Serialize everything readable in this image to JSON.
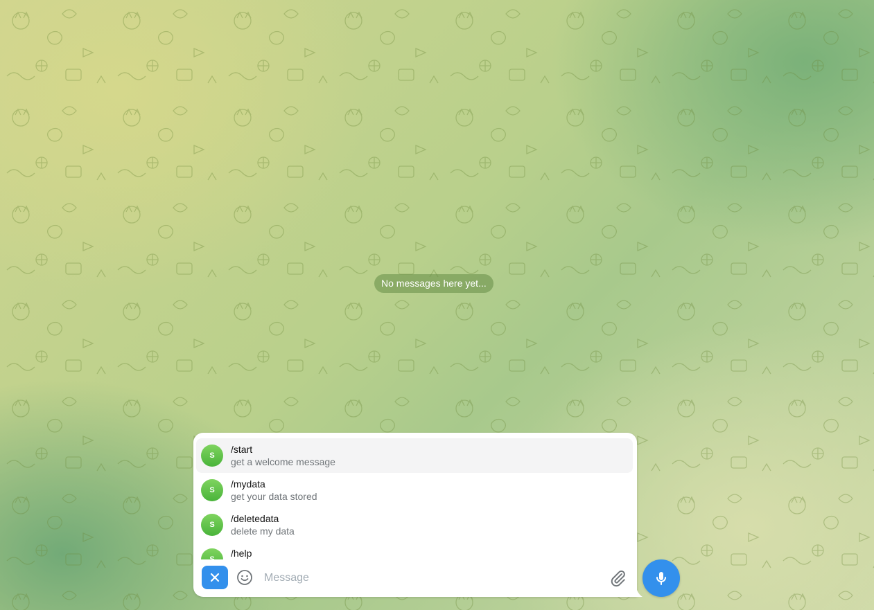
{
  "chat": {
    "empty_state": "No messages here yet..."
  },
  "commands": [
    {
      "avatar": "S",
      "name": "/start",
      "description": "get a welcome message"
    },
    {
      "avatar": "S",
      "name": "/mydata",
      "description": "get your data stored"
    },
    {
      "avatar": "S",
      "name": "/deletedata",
      "description": "delete my data"
    },
    {
      "avatar": "S",
      "name": "/help",
      "description": ""
    }
  ],
  "composer": {
    "placeholder": "Message",
    "close_icon": "close-icon",
    "emoji_icon": "smile-icon",
    "attach_icon": "paperclip-icon",
    "send_icon": "microphone-icon"
  },
  "colors": {
    "accent": "#3390ec",
    "avatar_green": "#4fbe3e"
  }
}
